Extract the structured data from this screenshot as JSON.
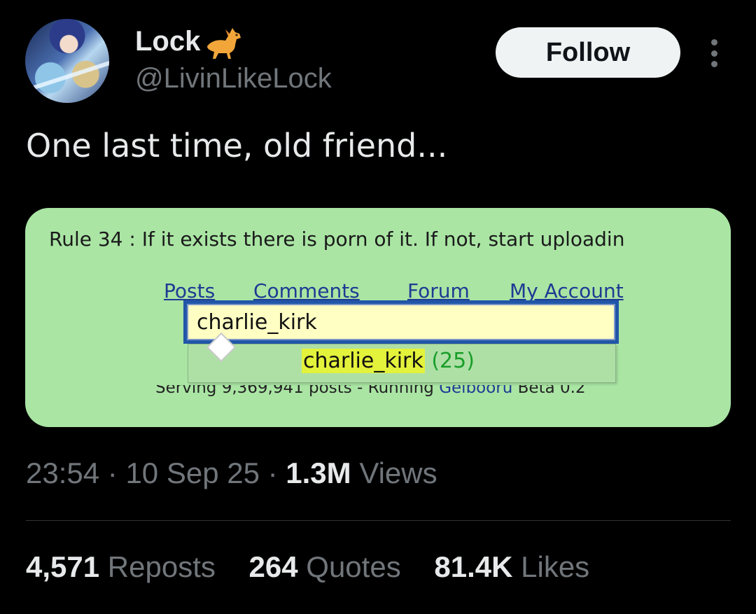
{
  "author": {
    "display_name": "Lock",
    "handle": "@LivinLikeLock",
    "name_emoji": "horse-icon"
  },
  "follow_label": "Follow",
  "tweet_text": "One last time, old friend...",
  "media": {
    "rule_text": "Rule 34 : If it exists there is porn of it. If not, start uploadin",
    "nav": [
      "Posts",
      "Comments",
      "Forum",
      "My Account"
    ],
    "search_value": "charlie_kirk",
    "suggestion": {
      "tag": "charlie_kirk",
      "count": "(25)"
    },
    "footer_prefix": "Serving 9,369,941 posts - Running ",
    "footer_link": "Gelbooru",
    "footer_suffix": " Beta 0.2"
  },
  "meta": {
    "time": "23:54",
    "sep1": " · ",
    "date": "10 Sep 25",
    "sep2": " · ",
    "views_count": "1.3M",
    "views_label": " Views"
  },
  "stats": [
    {
      "count": "4,571",
      "label": "Reposts"
    },
    {
      "count": "264",
      "label": "Quotes"
    },
    {
      "count": "81.4K",
      "label": "Likes"
    }
  ],
  "colors": {
    "background": "#000000",
    "text_primary": "#e7e9ea",
    "text_secondary": "#71767b",
    "media_bg": "#aae5a4",
    "highlight": "#e3f23a"
  }
}
